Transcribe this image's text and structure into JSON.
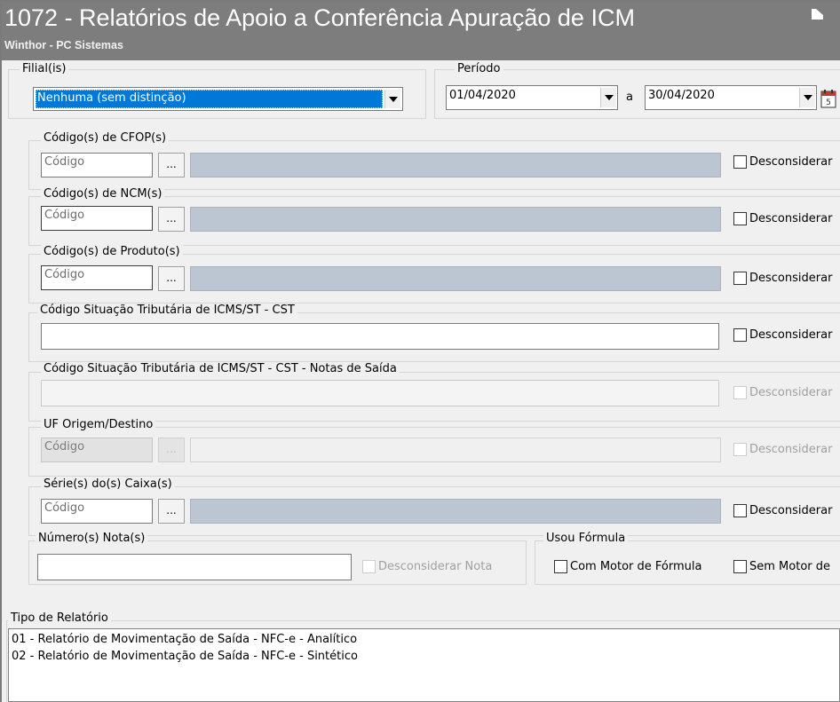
{
  "window": {
    "title": "1072 - Relatórios de Apoio a Conferência Apuração de ICM",
    "subtitle": "Winthor - PC Sistemas"
  },
  "filial": {
    "label": "Filial(is)",
    "selected": "Nenhuma (sem distinção)"
  },
  "periodo": {
    "label": "Período",
    "start": "01/04/2020",
    "separator": "a",
    "end": "30/04/2020"
  },
  "cfop": {
    "label": "Código(s) de CFOP(s)",
    "placeholder": "Código",
    "button": "...",
    "checkbox": "Desconsiderar"
  },
  "ncm": {
    "label": "Código(s) de NCM(s)",
    "placeholder": "Código",
    "button": "...",
    "checkbox": "Desconsiderar"
  },
  "produto": {
    "label": "Código(s) de Produto(s)",
    "placeholder": "Código",
    "button": "...",
    "checkbox": "Desconsiderar"
  },
  "cst": {
    "label": "Código Situação Tributária de ICMS/ST - CST",
    "value": "",
    "checkbox": "Desconsiderar"
  },
  "cst_saida": {
    "label": "Código Situação Tributária de ICMS/ST - CST -  Notas de Saída",
    "value": "",
    "checkbox": "Desconsiderar"
  },
  "uf": {
    "label": "UF Origem/Destino",
    "placeholder": "Código",
    "button": "...",
    "checkbox": "Desconsiderar"
  },
  "serie": {
    "label": "Série(s) do(s) Caixa(s)",
    "placeholder": "Código",
    "button": "...",
    "checkbox": "Desconsiderar"
  },
  "nota": {
    "label": "Número(s) Nota(s)",
    "value": "",
    "checkbox": "Desconsiderar Nota"
  },
  "formula": {
    "label": "Usou Fórmula",
    "option_com": "Com Motor de Fórmula",
    "option_sem": "Sem Motor de"
  },
  "tipo_relatorio": {
    "label": "Tipo de Relatório",
    "items": [
      "01 - Relatório de Movimentação de Saída - NFC-e - Analítico",
      "02 - Relatório de Movimentação de Saída - NFC-e - Sintético"
    ]
  }
}
